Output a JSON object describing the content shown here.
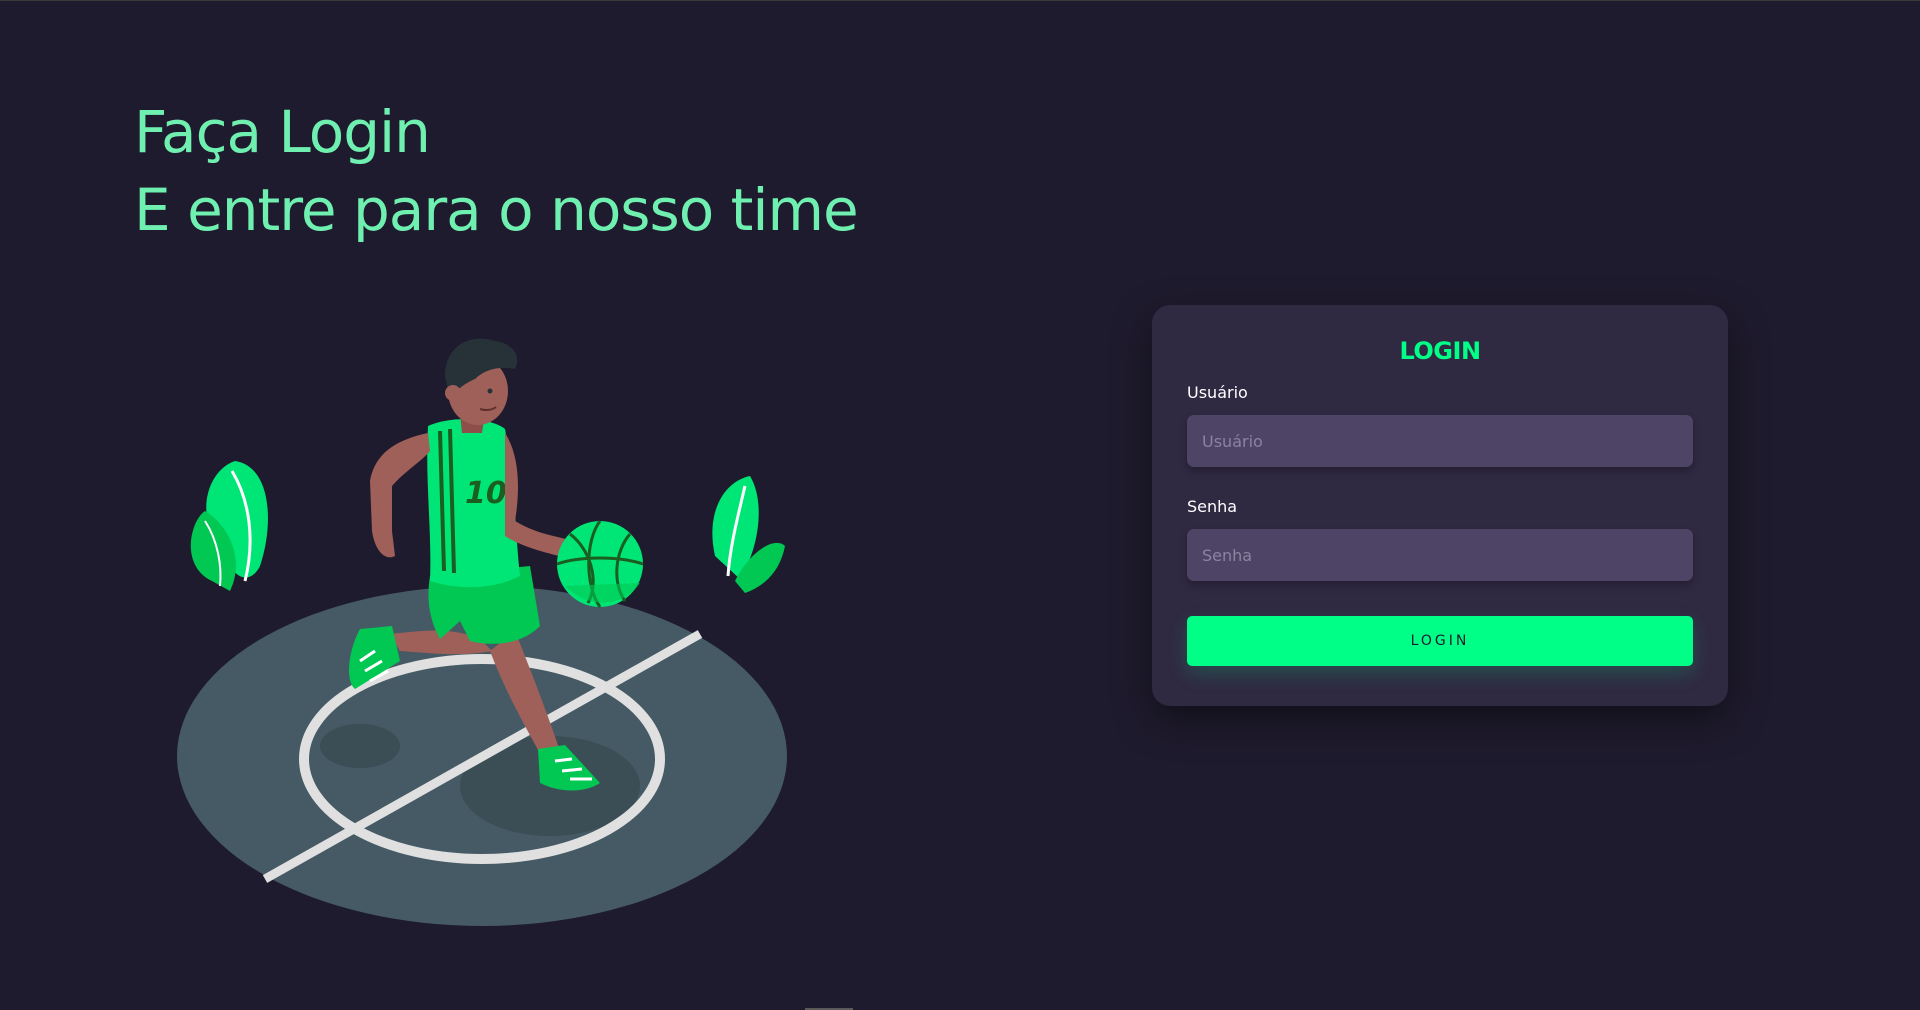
{
  "hero": {
    "title_line1": "Faça Login",
    "title_line2": "E entre para o nosso time",
    "jersey_number": "10"
  },
  "login_card": {
    "title": "LOGIN",
    "username": {
      "label": "Usuário",
      "placeholder": "Usuário",
      "value": ""
    },
    "password": {
      "label": "Senha",
      "placeholder": "Senha",
      "value": ""
    },
    "button_label": "LOGIN"
  },
  "colors": {
    "background": "#1f1b2e",
    "card": "#2f2942",
    "input": "#4e4466",
    "accent": "#00ff87",
    "headline": "#6ff0b0",
    "court": "#455a64"
  },
  "icons": [
    "basketball-player-illustration",
    "basketball-icon",
    "leaf-icon"
  ]
}
